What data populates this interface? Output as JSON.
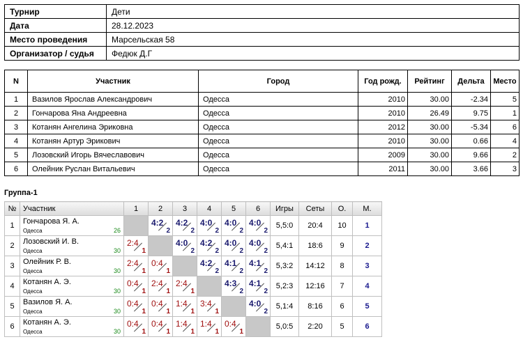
{
  "info": [
    {
      "label": "Турнир",
      "value": "Дети"
    },
    {
      "label": "Дата",
      "value": "28.12.2023"
    },
    {
      "label": "Место проведения",
      "value": "Марсельская 58"
    },
    {
      "label": "Организатор / судья",
      "value": "Федюк Д.Г"
    }
  ],
  "participants": {
    "headers": [
      "N",
      "Участник",
      "Город",
      "Год рожд.",
      "Рейтинг",
      "Дельта",
      "Место"
    ],
    "rows": [
      [
        "1",
        "Вазилов Ярослав Александрович",
        "Одесса",
        "2010",
        "30.00",
        "-2.34",
        "5"
      ],
      [
        "2",
        "Гончарова Яна Андреевна",
        "Одесса",
        "2010",
        "26.49",
        "9.75",
        "1"
      ],
      [
        "3",
        "Котанян Ангелина Эриковна",
        "Одесса",
        "2012",
        "30.00",
        "-5.34",
        "6"
      ],
      [
        "4",
        "Котанян Артур Эрикович",
        "Одесса",
        "2010",
        "30.00",
        "0.66",
        "4"
      ],
      [
        "5",
        "Лозовский Игорь Вячеславович",
        "Одесса",
        "2009",
        "30.00",
        "9.66",
        "2"
      ],
      [
        "6",
        "Олейник Руслан Витальевич",
        "Одесса",
        "2011",
        "30.00",
        "3.66",
        "3"
      ]
    ]
  },
  "group": {
    "title": "Группа-1",
    "headers": {
      "num": "№",
      "player": "Участник",
      "cols": [
        "1",
        "2",
        "3",
        "4",
        "5",
        "6"
      ],
      "games": "Игры",
      "sets": "Сеты",
      "points": "О.",
      "place": "М."
    },
    "rows": [
      {
        "n": "1",
        "name": "Гончарова Я. А.",
        "city": "Одесса",
        "rating": "26",
        "cells": [
          null,
          {
            "s": "4:2",
            "p": "2",
            "w": true
          },
          {
            "s": "4:2",
            "p": "2",
            "w": true
          },
          {
            "s": "4:0",
            "p": "2",
            "w": true
          },
          {
            "s": "4:0",
            "p": "2",
            "w": true
          },
          {
            "s": "4:0",
            "p": "2",
            "w": true
          }
        ],
        "games": "5,5:0",
        "sets": "20:4",
        "points": "10",
        "place": "1"
      },
      {
        "n": "2",
        "name": "Лозовский И. В.",
        "city": "Одесса",
        "rating": "30",
        "cells": [
          {
            "s": "2:4",
            "p": "1",
            "w": false
          },
          null,
          {
            "s": "4:0",
            "p": "2",
            "w": true
          },
          {
            "s": "4:2",
            "p": "2",
            "w": true
          },
          {
            "s": "4:0",
            "p": "2",
            "w": true
          },
          {
            "s": "4:0",
            "p": "2",
            "w": true
          }
        ],
        "games": "5,4:1",
        "sets": "18:6",
        "points": "9",
        "place": "2"
      },
      {
        "n": "3",
        "name": "Олейник Р. В.",
        "city": "Одесса",
        "rating": "30",
        "cells": [
          {
            "s": "2:4",
            "p": "1",
            "w": false
          },
          {
            "s": "0:4",
            "p": "1",
            "w": false
          },
          null,
          {
            "s": "4:2",
            "p": "2",
            "w": true
          },
          {
            "s": "4:1",
            "p": "2",
            "w": true
          },
          {
            "s": "4:1",
            "p": "2",
            "w": true
          }
        ],
        "games": "5,3:2",
        "sets": "14:12",
        "points": "8",
        "place": "3"
      },
      {
        "n": "4",
        "name": "Котанян А. Э.",
        "city": "Одесса",
        "rating": "30",
        "cells": [
          {
            "s": "0:4",
            "p": "1",
            "w": false
          },
          {
            "s": "2:4",
            "p": "1",
            "w": false
          },
          {
            "s": "2:4",
            "p": "1",
            "w": false
          },
          null,
          {
            "s": "4:3",
            "p": "2",
            "w": true
          },
          {
            "s": "4:1",
            "p": "2",
            "w": true
          }
        ],
        "games": "5,2:3",
        "sets": "12:16",
        "points": "7",
        "place": "4"
      },
      {
        "n": "5",
        "name": "Вазилов Я. А.",
        "city": "Одесса",
        "rating": "30",
        "cells": [
          {
            "s": "0:4",
            "p": "1",
            "w": false
          },
          {
            "s": "0:4",
            "p": "1",
            "w": false
          },
          {
            "s": "1:4",
            "p": "1",
            "w": false
          },
          {
            "s": "3:4",
            "p": "1",
            "w": false
          },
          null,
          {
            "s": "4:0",
            "p": "2",
            "w": true
          }
        ],
        "games": "5,1:4",
        "sets": "8:16",
        "points": "6",
        "place": "5"
      },
      {
        "n": "6",
        "name": "Котанян А. Э.",
        "city": "Одесса",
        "rating": "30",
        "cells": [
          {
            "s": "0:4",
            "p": "1",
            "w": false
          },
          {
            "s": "0:4",
            "p": "1",
            "w": false
          },
          {
            "s": "1:4",
            "p": "1",
            "w": false
          },
          {
            "s": "1:4",
            "p": "1",
            "w": false
          },
          {
            "s": "0:4",
            "p": "1",
            "w": false
          },
          null
        ],
        "games": "5,0:5",
        "sets": "2:20",
        "points": "5",
        "place": "6"
      }
    ]
  }
}
